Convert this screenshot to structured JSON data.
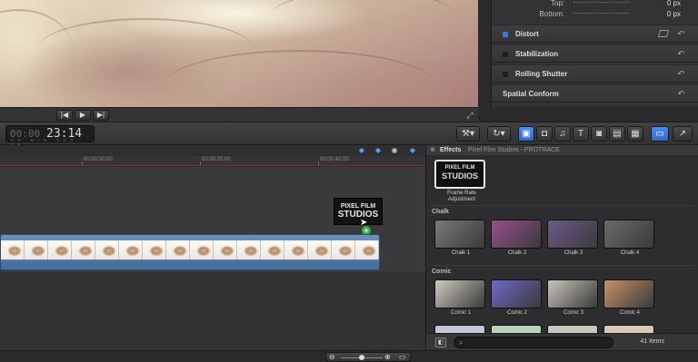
{
  "inspector": {
    "params": [
      {
        "label": "Top:",
        "value": "0 px"
      },
      {
        "label": "Bottom:",
        "value": "0 px"
      }
    ],
    "sections": [
      {
        "label": "Distort",
        "enabled": true
      },
      {
        "label": "Stabilization",
        "enabled": false
      },
      {
        "label": "Rolling Shutter",
        "enabled": false
      },
      {
        "label": "Spatial Conform",
        "enabled": false
      }
    ],
    "reset_icon": "reset-arrow-icon"
  },
  "viewer": {
    "transport": {
      "prev": "|◀",
      "play": "▶",
      "next": "▶|"
    },
    "fullscreen": "⤢"
  },
  "toolbar": {
    "timecode_hours": "00:00",
    "timecode_value": "23:14",
    "timecode_units": "HR MIN SEC FR"
  },
  "timeline": {
    "ruler_labels": [
      "00:00:30:00",
      "00:00:35:00",
      "00:00:40:00"
    ],
    "adjustment_clip": {
      "line1": "PIXEL FILM",
      "line2": "STUDIOS"
    },
    "add_badge": "+"
  },
  "effects": {
    "title": "Effects",
    "breadcrumb": "Pixel Film Studios - PROTRACE",
    "top_item": {
      "label": "Frame Rate Adjustment",
      "brand1": "PIXEL FILM",
      "brand2": "STUDIOS"
    },
    "sections": [
      {
        "name": "Chalk",
        "items": [
          {
            "label": "Chalk 1",
            "color": "#7a7a7a"
          },
          {
            "label": "Chalk 2",
            "color": "#9a4f8c"
          },
          {
            "label": "Chalk 3",
            "color": "#6e5a8a"
          },
          {
            "label": "Chalk 4",
            "color": "#6b6b6b"
          }
        ]
      },
      {
        "name": "Comic",
        "items": [
          {
            "label": "Comic 1",
            "color": "#cfcac0"
          },
          {
            "label": "Comic 2",
            "color": "#6f68c8"
          },
          {
            "label": "Comic 3",
            "color": "#c8c4bc"
          },
          {
            "label": "Comic 4",
            "color": "#c89066"
          }
        ]
      }
    ],
    "count": "41 items"
  }
}
